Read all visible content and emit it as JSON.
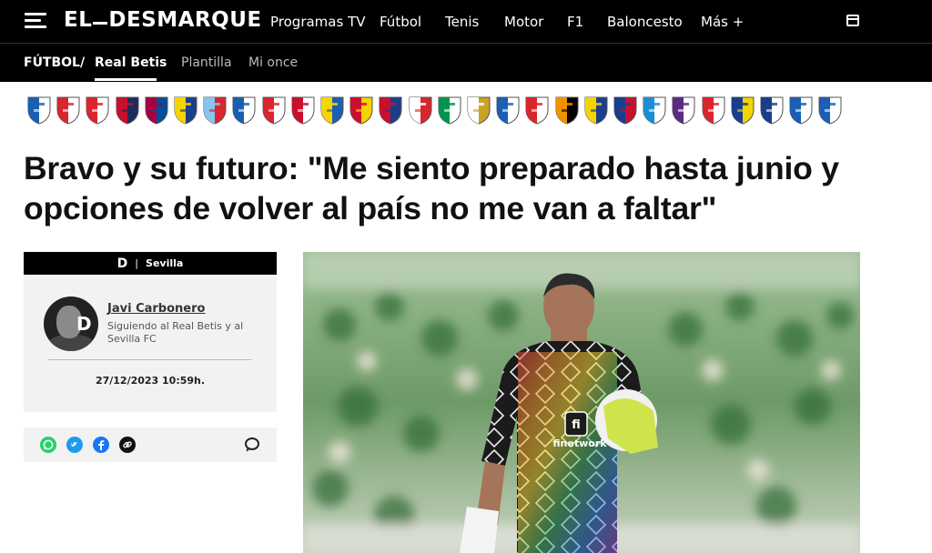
{
  "site": {
    "logo_left": "EL",
    "logo_right": "DESMARQUE",
    "nav": [
      "Programas TV",
      "Fútbol",
      "Tenis",
      "Motor",
      "F1",
      "Baloncesto",
      "Más +"
    ]
  },
  "breadcrumb": {
    "section": "FÚTBOL",
    "separator": "/",
    "current": "Real Betis",
    "tabs": [
      "Plantilla",
      "Mi once"
    ]
  },
  "crests": [
    {
      "team": "alaves",
      "colors": [
        "#1a5fb4",
        "#ffffff"
      ]
    },
    {
      "team": "almeria",
      "colors": [
        "#d8262e",
        "#ffffff"
      ]
    },
    {
      "team": "athletic",
      "colors": [
        "#d8262e",
        "#ffffff"
      ]
    },
    {
      "team": "atletico",
      "colors": [
        "#c8102e",
        "#1c2c5b"
      ]
    },
    {
      "team": "barcelona",
      "colors": [
        "#a50044",
        "#004d98"
      ]
    },
    {
      "team": "cadiz",
      "colors": [
        "#f5d400",
        "#1a3e8c"
      ]
    },
    {
      "team": "celta",
      "colors": [
        "#8ac3ee",
        "#d8262e"
      ]
    },
    {
      "team": "getafe",
      "colors": [
        "#1a5fb4",
        "#ffffff"
      ]
    },
    {
      "team": "girona",
      "colors": [
        "#d8262e",
        "#ffffff"
      ]
    },
    {
      "team": "granada",
      "colors": [
        "#c8102e",
        "#ffffff"
      ]
    },
    {
      "team": "las-palmas",
      "colors": [
        "#f5d400",
        "#1a5fb4"
      ]
    },
    {
      "team": "mallorca",
      "colors": [
        "#c8102e",
        "#f5d400"
      ]
    },
    {
      "team": "osasuna",
      "colors": [
        "#c8102e",
        "#1a3e8c"
      ]
    },
    {
      "team": "rayo",
      "colors": [
        "#ffffff",
        "#d8262e"
      ]
    },
    {
      "team": "betis",
      "colors": [
        "#00954c",
        "#ffffff"
      ]
    },
    {
      "team": "real-madrid",
      "colors": [
        "#ffffff",
        "#c9a227"
      ]
    },
    {
      "team": "real-sociedad",
      "colors": [
        "#1a5fb4",
        "#ffffff"
      ]
    },
    {
      "team": "sevilla",
      "colors": [
        "#d8262e",
        "#ffffff"
      ]
    },
    {
      "team": "valencia",
      "colors": [
        "#f29100",
        "#000000"
      ]
    },
    {
      "team": "villarreal",
      "colors": [
        "#f5d400",
        "#1a3e8c"
      ]
    },
    {
      "team": "levante",
      "colors": [
        "#1a3e8c",
        "#c8102e"
      ]
    },
    {
      "team": "malaga",
      "colors": [
        "#1a8fd8",
        "#ffffff"
      ]
    },
    {
      "team": "valladolid",
      "colors": [
        "#5b2c83",
        "#ffffff"
      ]
    },
    {
      "team": "sporting",
      "colors": [
        "#d8262e",
        "#ffffff"
      ]
    },
    {
      "team": "oviedo",
      "colors": [
        "#1a3e8c",
        "#f5d400"
      ]
    },
    {
      "team": "zaragoza",
      "colors": [
        "#1a3e8c",
        "#ffffff"
      ]
    },
    {
      "team": "deportivo",
      "colors": [
        "#1a5fb4",
        "#ffffff"
      ]
    },
    {
      "team": "tenerife",
      "colors": [
        "#1a5fb4",
        "#ffffff"
      ]
    }
  ],
  "article": {
    "headline": "Bravo y su futuro: \"Me siento preparado hasta junio y opciones de volver al país no me van a faltar\"",
    "source_logo": "D",
    "source": "Sevilla",
    "author": {
      "name": "Javi Carbonero",
      "description": "Siguiendo al Real Betis y al Sevilla FC"
    },
    "date": "27/12/2023 10:59h.",
    "photo_text": "finetwork",
    "share": {
      "whatsapp_color": "#25d366",
      "twitter_color": "#1d9bf0",
      "facebook_color": "#1877f2",
      "link_color": "#111111"
    }
  }
}
